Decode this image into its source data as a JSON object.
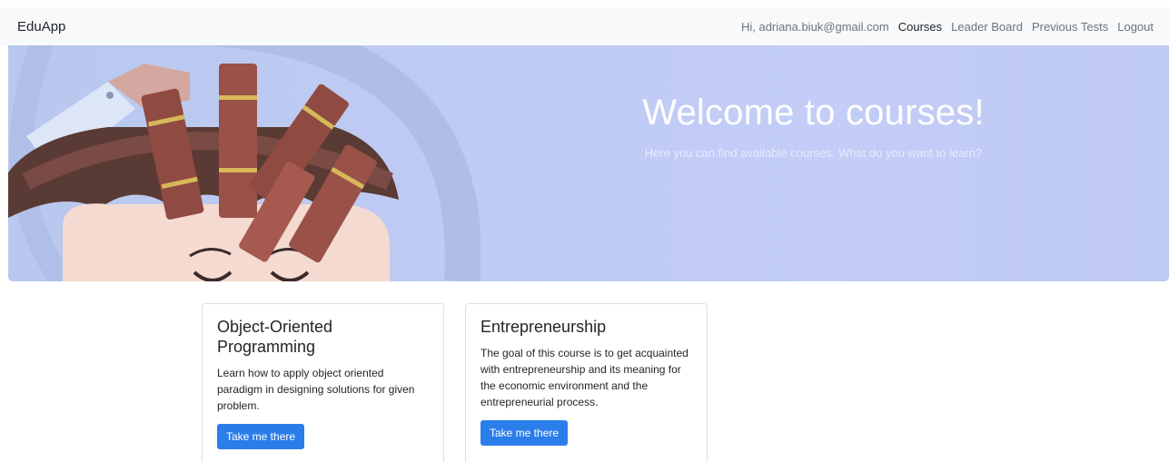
{
  "navbar": {
    "brand": "EduApp",
    "greeting": "Hi, adriana.biuk@gmail.com",
    "links": [
      "Courses",
      "Leader Board",
      "Previous Tests",
      "Logout"
    ]
  },
  "hero": {
    "title": "Welcome to courses!",
    "subtitle": "Here you can find available courses. What do you want to learn?"
  },
  "courses": [
    {
      "title": "Object-Oriented Programming",
      "description": "Learn how to apply object oriented paradigm in designing solutions for given problem.",
      "button": "Take me there"
    },
    {
      "title": "Entrepreneurship",
      "description": "The goal of this course is to get acquainted with entrepreneurship and its meaning for the economic environment and the entrepreneurial process.",
      "button": "Take me there"
    }
  ],
  "colors": {
    "navbar_bg": "#f8f9fa",
    "hero_bg": "#bfcbf4",
    "button": "#2b7de9"
  }
}
